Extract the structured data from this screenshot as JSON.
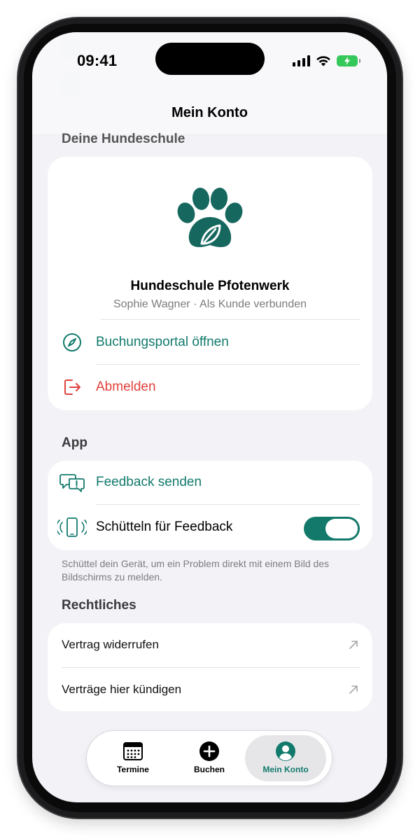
{
  "status_bar": {
    "time": "09:41"
  },
  "header": {
    "title": "Mein Konto"
  },
  "school_section": {
    "label": "Deine Hundeschule",
    "name": "Hundeschule Pfotenwerk",
    "subtitle": "Sophie Wagner · Als Kunde verbunden",
    "logo_icon": "paw-leaf-logo",
    "actions": [
      {
        "label": "Buchungsportal öffnen",
        "icon": "compass-icon",
        "color": "#127a6c"
      },
      {
        "label": "Abmelden",
        "icon": "logout-icon",
        "color": "#e0413c"
      }
    ]
  },
  "app_section": {
    "label": "App",
    "feedback_label": "Feedback senden",
    "shake_label": "Schütteln für Feedback",
    "shake_enabled": true,
    "footnote": "Schüttel dein Gerät, um ein Problem direkt mit einem Bild des Bildschirms zu melden."
  },
  "legal_section": {
    "label": "Rechtliches",
    "items": [
      {
        "label": "Vertrag widerrufen",
        "icon": "external-arrow-icon"
      },
      {
        "label": "Verträge hier kündigen",
        "icon": "external-arrow-icon"
      }
    ]
  },
  "tabbar": {
    "tabs": [
      {
        "label": "Termine",
        "icon": "calendar-icon",
        "active": false
      },
      {
        "label": "Buchen",
        "icon": "plus-circle-icon",
        "active": false
      },
      {
        "label": "Mein Konto",
        "icon": "person-circle-icon",
        "active": true
      }
    ]
  },
  "colors": {
    "accent": "#127a6c",
    "destructive": "#e0413c",
    "background": "#f2f2f7",
    "battery": "#34c759"
  }
}
